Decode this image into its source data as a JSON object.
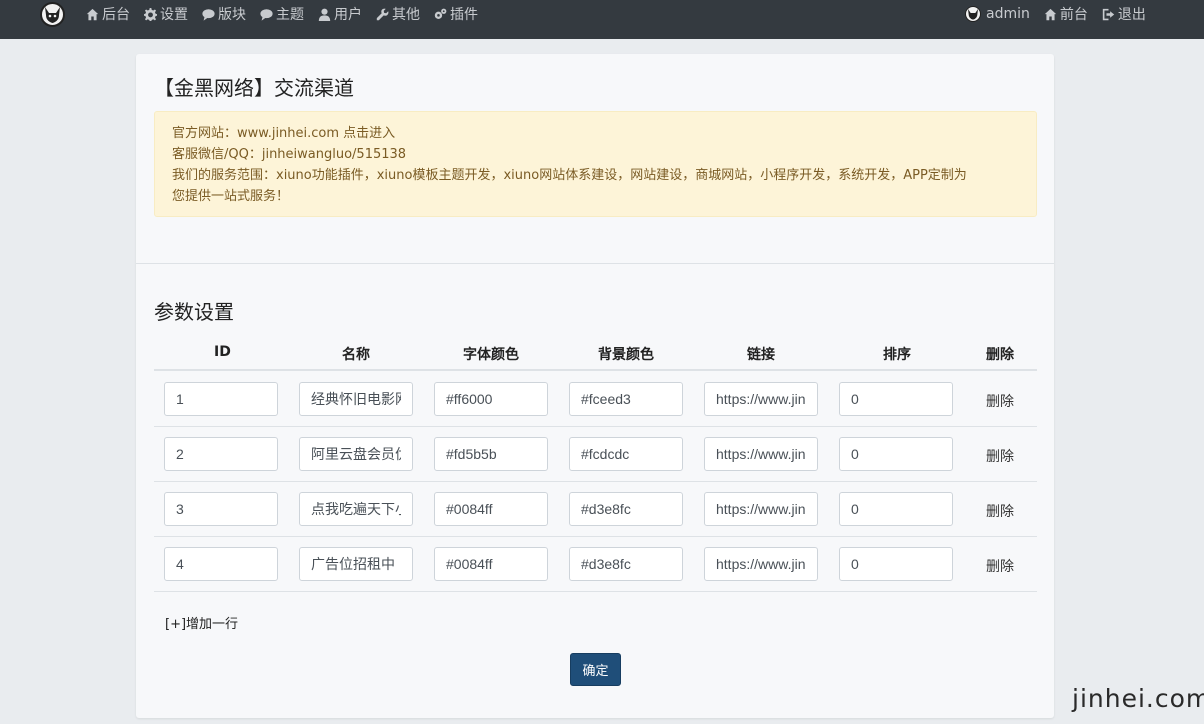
{
  "nav": {
    "left": [
      {
        "label": "后台",
        "icon": "home-icon"
      },
      {
        "label": "设置",
        "icon": "gear-icon"
      },
      {
        "label": "版块",
        "icon": "comment-icon"
      },
      {
        "label": "主题",
        "icon": "comment-icon"
      },
      {
        "label": "用户",
        "icon": "user-icon"
      },
      {
        "label": "其他",
        "icon": "wrench-icon"
      },
      {
        "label": "插件",
        "icon": "gears-icon"
      }
    ],
    "right": [
      {
        "label": "admin",
        "icon": "avatar"
      },
      {
        "label": "前台",
        "icon": "home-icon"
      },
      {
        "label": "退出",
        "icon": "logout-icon"
      }
    ]
  },
  "card": {
    "title": "【金黑网络】交流渠道",
    "alert_lines": [
      "官方网站：www.jinhei.com 点击进入",
      "客服微信/QQ：jinheiwangluo/515138",
      "我们的服务范围：xiuno功能插件，xiuno模板主题开发，xiuno网站体系建设，网站建设，商城网站，小程序开发，系统开发，APP定制为",
      "您提供一站式服务！"
    ],
    "section_title": "参数设置"
  },
  "table": {
    "headers": [
      "ID",
      "名称",
      "字体颜色",
      "背景颜色",
      "链接",
      "排序",
      "删除"
    ],
    "rows": [
      {
        "id": "1",
        "name": "经典怀旧电影网",
        "color": "#ff6000",
        "bg": "#fceed3",
        "link": "https://www.jinhei.com",
        "sort": "0",
        "delete": "删除"
      },
      {
        "id": "2",
        "name": "阿里云盘会员优惠",
        "color": "#fd5b5b",
        "bg": "#fcdcdc",
        "link": "https://www.jinhei.com",
        "sort": "0",
        "delete": "删除"
      },
      {
        "id": "3",
        "name": "点我吃遍天下小吃",
        "color": "#0084ff",
        "bg": "#d3e8fc",
        "link": "https://www.jinhei.com",
        "sort": "0",
        "delete": "删除"
      },
      {
        "id": "4",
        "name": "广告位招租中",
        "color": "#0084ff",
        "bg": "#d3e8fc",
        "link": "https://www.jinhei.com",
        "sort": "0",
        "delete": "删除"
      }
    ]
  },
  "add_row_label": "[+]增加一行",
  "confirm_label": "确定",
  "watermark": "jinhei.com",
  "colors": {
    "topbar": "#343a40",
    "primary_button": "#1f4e79",
    "alert_bg": "#fdf4d8"
  }
}
